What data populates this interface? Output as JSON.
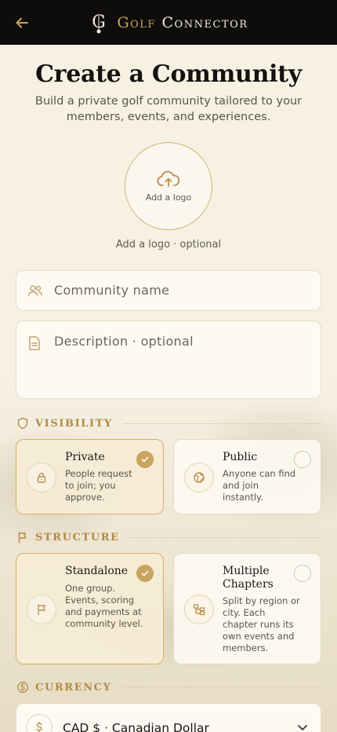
{
  "header": {
    "brand_first": "Golf",
    "brand_second": "Connector",
    "back_icon": "arrow-left-icon",
    "logo_glyph": "G"
  },
  "page": {
    "title": "Create a Community",
    "subtitle": "Build a private golf community tailored to your members, events, and experiences."
  },
  "logo_upload": {
    "button_label": "Add a logo",
    "hint": "Add a logo · optional",
    "icon": "cloud-upload-icon"
  },
  "form": {
    "name_placeholder": "Community name",
    "description_placeholder": "Description · optional"
  },
  "visibility": {
    "heading": "VISIBILITY",
    "options": [
      {
        "title": "Private",
        "description": "People request to join; you approve.",
        "selected": true,
        "icon": "lock-icon"
      },
      {
        "title": "Public",
        "description": "Anyone can find and join instantly.",
        "selected": false,
        "icon": "globe-icon"
      }
    ]
  },
  "structure": {
    "heading": "STRUCTURE",
    "options": [
      {
        "title": "Standalone",
        "description": "One group. Events, scoring and payments at community level.",
        "selected": true,
        "icon": "flag-icon"
      },
      {
        "title": "Multiple Chapters",
        "description": "Split by region or city. Each chapter runs its own events and members.",
        "selected": false,
        "icon": "hierarchy-icon"
      }
    ]
  },
  "currency": {
    "heading": "CURRENCY",
    "selected": "CAD $ · Canadian Dollar"
  },
  "colors": {
    "accent": "#c9a45e",
    "header_bg": "#0e0d0b",
    "page_bg": "#f7f1e4"
  }
}
